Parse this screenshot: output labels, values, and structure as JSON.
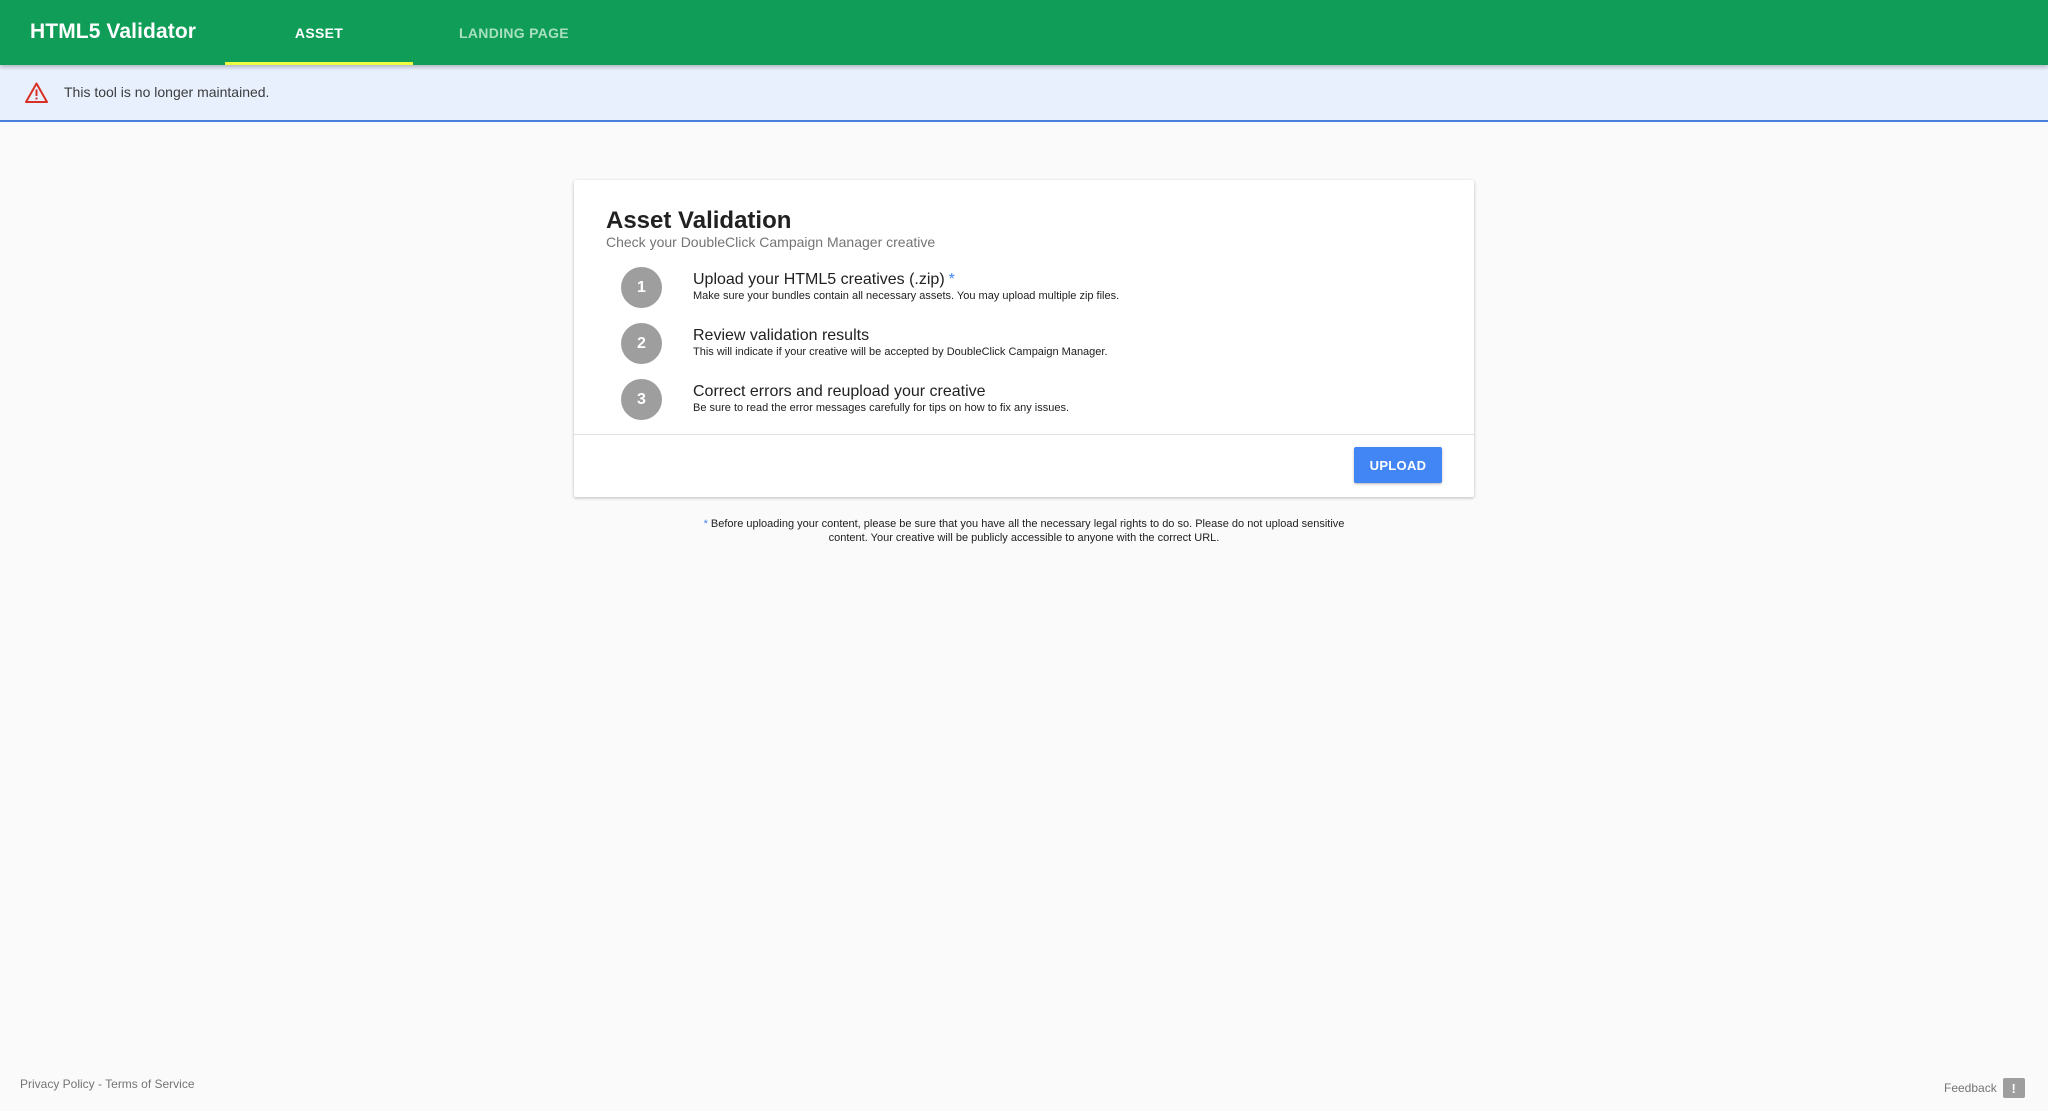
{
  "header": {
    "app_title": "HTML5 Validator",
    "tabs": [
      {
        "label": "ASSET",
        "active": true
      },
      {
        "label": "LANDING PAGE",
        "active": false
      }
    ],
    "colors": {
      "bar": "#0f9d58",
      "tab_indicator": "#eeff41"
    }
  },
  "notice": {
    "icon": "warning-icon",
    "text": "This tool is no longer maintained."
  },
  "card": {
    "title": "Asset Validation",
    "subtitle": "Check your DoubleClick Campaign Manager creative",
    "steps": [
      {
        "number": "1",
        "title": "Upload your HTML5 creatives (.zip)",
        "required_mark": "*",
        "description": "Make sure your bundles contain all necessary assets. You may upload multiple zip files."
      },
      {
        "number": "2",
        "title": "Review validation results",
        "description": "This will indicate if your creative will be accepted by DoubleClick Campaign Manager."
      },
      {
        "number": "3",
        "title": "Correct errors and reupload your creative",
        "description": "Be sure to read the error messages carefully for tips on how to fix any issues."
      }
    ],
    "upload_label": "UPLOAD"
  },
  "disclaimer": {
    "mark": "*",
    "line1": "Before uploading your content, please be sure that you have all the necessary legal rights to do so. Please do not upload sensitive",
    "line2": "content. Your creative will be publicly accessible to anyone with the correct URL."
  },
  "footer": {
    "privacy_label": "Privacy Policy",
    "separator": " - ",
    "terms_label": "Terms of Service",
    "feedback_label": "Feedback",
    "feedback_icon": "feedback-icon"
  }
}
